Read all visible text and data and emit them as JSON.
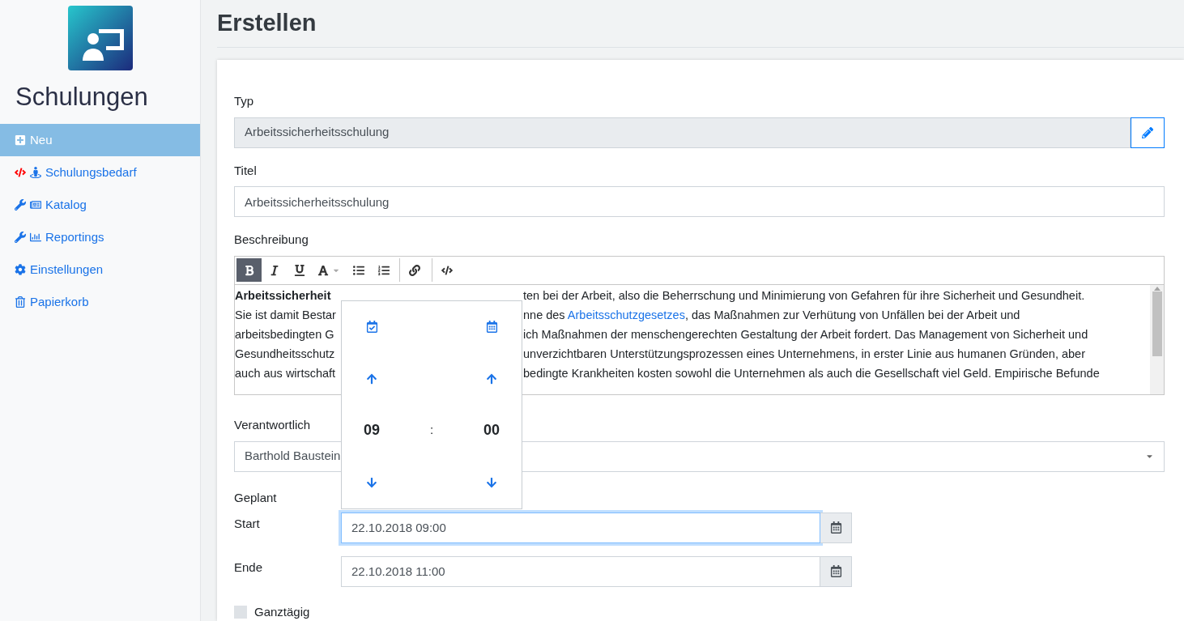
{
  "sidebar": {
    "app_title": "Schulungen",
    "items": [
      {
        "label": "Neu",
        "selected": true
      },
      {
        "label": "Schulungsbedarf",
        "selected": false
      },
      {
        "label": "Katalog",
        "selected": false
      },
      {
        "label": "Reportings",
        "selected": false
      },
      {
        "label": "Einstellungen",
        "selected": false
      },
      {
        "label": "Papierkorb",
        "selected": false
      }
    ]
  },
  "page_title": "Erstellen",
  "form": {
    "type": {
      "label": "Typ",
      "value": "Arbeitssicherheitsschulung"
    },
    "title": {
      "label": "Titel",
      "value": "Arbeitssicherheitsschulung"
    },
    "description": {
      "label": "Beschreibung",
      "toolbar": [
        {
          "kind": "bold",
          "selected": true
        },
        {
          "kind": "italic",
          "selected": false
        },
        {
          "kind": "underline",
          "selected": false
        },
        {
          "kind": "color",
          "selected": false
        },
        {
          "kind": "bullets",
          "selected": false
        },
        {
          "kind": "numbers",
          "selected": false
        },
        {
          "kind": "link",
          "selected": false
        },
        {
          "kind": "code",
          "selected": false
        }
      ],
      "lines": [
        {
          "left": "**Arbeitssicherheit**",
          "right": "ten bei der Arbeit, also die Beherrschung und Minimierung von Gefahren für ihre Sicherheit und Gesundheit."
        },
        {
          "left": "Sie ist damit Bestar",
          "right": "nne des",
          "link": "Arbeitsschutzgesetzes",
          "rest": ", das Maßnahmen zur Verhütung von Unfällen bei der Arbeit und"
        },
        {
          "left": "arbeitsbedingten G",
          "right": "ich Maßnahmen der menschengerechten Gestaltung der Arbeit fordert. Das Management von Sicherheit und"
        },
        {
          "left": "Gesundheitsschutz",
          "right": "unverzichtbaren Unterstützungsprozessen eines Unternehmens, in erster Linie aus humanen Gründen, aber"
        },
        {
          "left": "auch aus wirtschaft",
          "right": "bedingte Krankheiten kosten sowohl die Unternehmen als auch die Gesellschaft viel Geld. Empirische Befunde"
        }
      ]
    },
    "responsible": {
      "label": "Verantwortlich",
      "value": "Barthold Baustein"
    },
    "planned": {
      "label": "Geplant",
      "start": {
        "label": "Start",
        "value": "22.10.2018 09:00",
        "focused": true
      },
      "end": {
        "label": "Ende",
        "value": "22.10.2018 11:00",
        "focused": false
      }
    },
    "all_day": {
      "label": "Ganztägig",
      "checked": false
    }
  },
  "time_picker": {
    "hours": "09",
    "separator": ":",
    "minutes": "00"
  }
}
